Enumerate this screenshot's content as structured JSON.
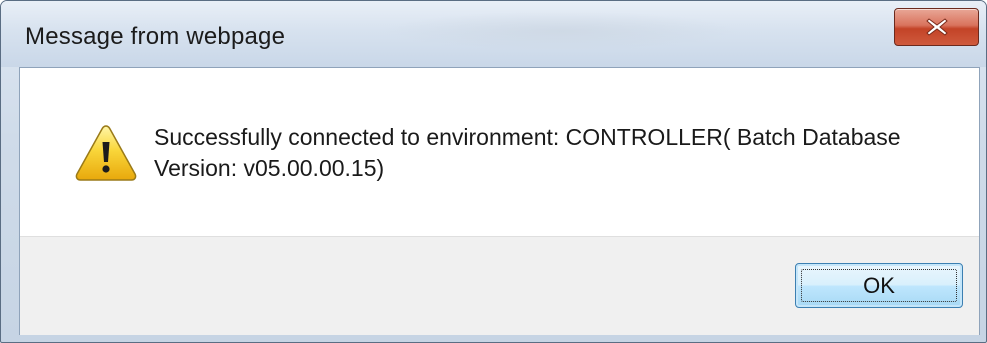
{
  "dialog": {
    "title": "Message from webpage",
    "close_icon": "close-x-icon",
    "message_icon": "warning-icon",
    "message_line1": "Successfully connected to environment: CONTROLLER( Batch Database",
    "message_line2": "Version: v05.00.00.15)",
    "ok_label": "OK"
  },
  "colors": {
    "close_button": "#c34327",
    "ok_button_border": "#3c7fb1",
    "warning_yellow": "#f6c51a"
  }
}
